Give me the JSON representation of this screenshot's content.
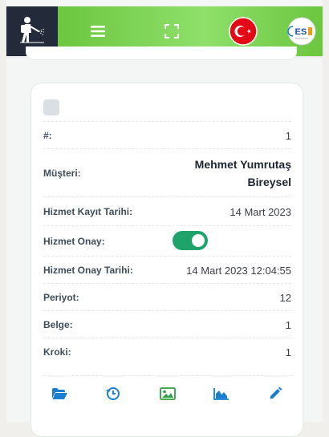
{
  "header": {
    "logo_icon": "pest-control-sprayer-icon",
    "menu_icon": "hamburger-menu-icon",
    "fullscreen_icon": "fullscreen-icon",
    "language_flag": "turkey-flag-icon",
    "avatar_text": "ES",
    "colors": {
      "logo_bg": "#232a39",
      "nav_green": "#6cc63f",
      "accent_green": "#1fa36b",
      "icon_blue": "#1b7fd1"
    }
  },
  "record": {
    "id_label": "#:",
    "id_value": "1",
    "customer_label": "Müşteri:",
    "customer_name": "Mehmet Yumrutaş",
    "customer_type": "Bireysel",
    "registration_label": "Hizmet Kayıt Tarihi:",
    "registration_date": "14 Mart 2023",
    "approval_label": "Hizmet Onay:",
    "approval_on": true,
    "approval_date_label": "Hizmet Onay Tarihi:",
    "approval_date": "14 Mart 2023 12:04:55",
    "period_label": "Periyot:",
    "period_value": "12",
    "document_label": "Belge:",
    "document_value": "1",
    "sketch_label": "Kroki:",
    "sketch_value": "1"
  },
  "actions": [
    {
      "icon": "folder-open-icon"
    },
    {
      "icon": "clock-history-icon"
    },
    {
      "icon": "image-icon"
    },
    {
      "icon": "area-chart-icon"
    },
    {
      "icon": "pencil-edit-icon"
    }
  ]
}
